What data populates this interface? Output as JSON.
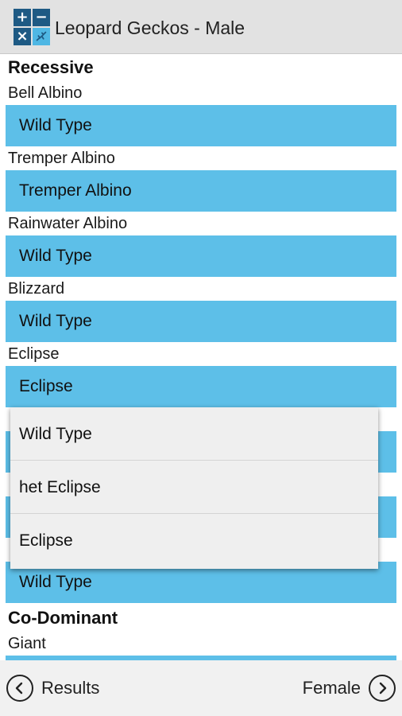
{
  "app": {
    "title": "Leopard Geckos - Male"
  },
  "icons": {
    "app_icon": "calculator-gecko-icon",
    "prev": "chevron-left-circle-icon",
    "next": "chevron-right-circle-icon"
  },
  "app_icon_glyphs": {
    "plus": "+",
    "minus": "−",
    "times": "×",
    "gecko": "🦎"
  },
  "sections": {
    "recessive": "Recessive",
    "co_dominant": "Co-Dominant"
  },
  "genes": [
    {
      "label": "Bell Albino",
      "value": "Wild Type"
    },
    {
      "label": "Tremper Albino",
      "value": "Tremper Albino"
    },
    {
      "label": "Rainwater Albino",
      "value": "Wild Type"
    },
    {
      "label": "Blizzard",
      "value": "Wild Type"
    },
    {
      "label": "Eclipse",
      "value": "Eclipse"
    },
    {
      "label": "",
      "value": "Wild Type"
    }
  ],
  "co_dominant_genes": [
    {
      "label": "Giant"
    }
  ],
  "dropdown": {
    "options": [
      "Wild Type",
      "het Eclipse",
      "Eclipse"
    ]
  },
  "nav": {
    "prev_label": "Results",
    "next_label": "Female"
  },
  "colors": {
    "select_bg": "#5dbfe8",
    "appbar_bg": "#e2e2e2",
    "icon_dark": "#1e5a84"
  }
}
